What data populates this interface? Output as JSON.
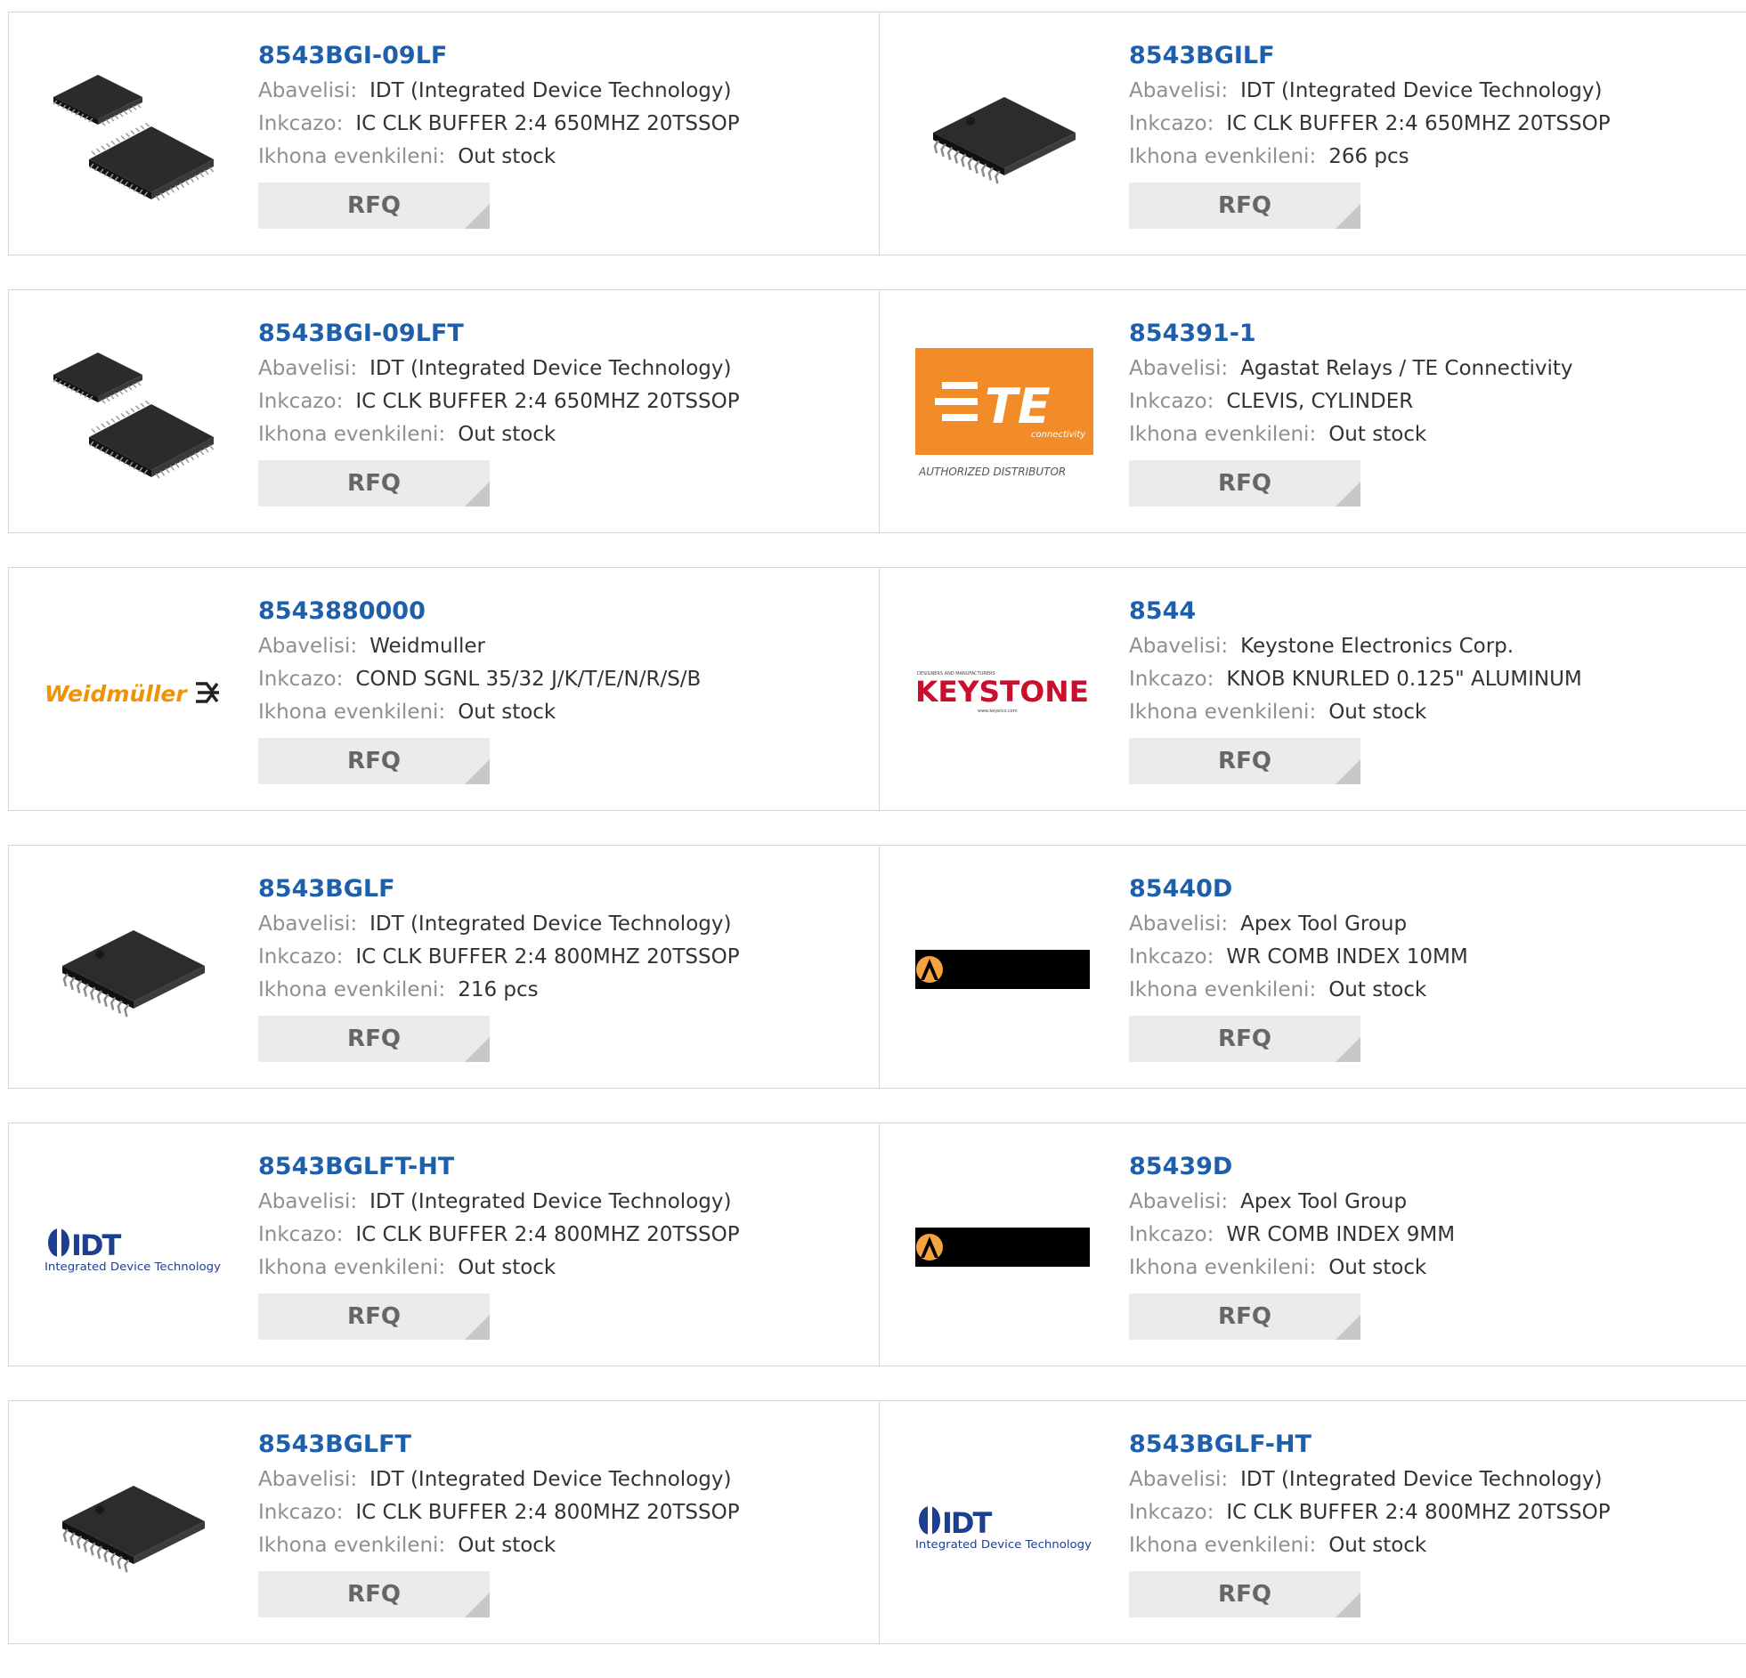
{
  "labels": {
    "manufacturer": "Abavelisi:",
    "description": "Inkcazo:",
    "stock": "Ikhona evenkileni:",
    "rfq": "RFQ"
  },
  "rows": [
    [
      {
        "pn": "8543BGI-09LF",
        "manufacturer": "IDT (Integrated Device Technology)",
        "description": "IC CLK BUFFER 2:4 650MHZ 20TSSOP",
        "stock": "Out stock",
        "image": "chip-qfp-pair-icon"
      },
      {
        "pn": "8543BGILF",
        "manufacturer": "IDT (Integrated Device Technology)",
        "description": "IC CLK BUFFER 2:4 650MHZ 20TSSOP",
        "stock": "266 pcs",
        "image": "chip-tssop-icon"
      }
    ],
    [
      {
        "pn": "8543BGI-09LFT",
        "manufacturer": "IDT (Integrated Device Technology)",
        "description": "IC CLK BUFFER 2:4 650MHZ 20TSSOP",
        "stock": "Out stock",
        "image": "chip-qfp-pair-icon"
      },
      {
        "pn": "854391-1",
        "manufacturer": "Agastat Relays / TE Connectivity",
        "description": "CLEVIS, CYLINDER",
        "stock": "Out stock",
        "image": "te-logo",
        "logo_text": "TE",
        "logo_sub": "connectivity",
        "logo_caption": "AUTHORIZED DISTRIBUTOR"
      }
    ],
    [
      {
        "pn": "8543880000",
        "manufacturer": "Weidmuller",
        "description": "COND SGNL 35/32 J/K/T/E/N/R/S/B",
        "stock": "Out stock",
        "image": "weidmuller-logo",
        "logo_text": "Weidmüller"
      },
      {
        "pn": "8544",
        "manufacturer": "Keystone Electronics Corp.",
        "description": "KNOB KNURLED 0.125\" ALUMINUM",
        "stock": "Out stock",
        "image": "keystone-logo",
        "logo_text": "KEYSTONE"
      }
    ],
    [
      {
        "pn": "8543BGLF",
        "manufacturer": "IDT (Integrated Device Technology)",
        "description": "IC CLK BUFFER 2:4 800MHZ 20TSSOP",
        "stock": "216 pcs",
        "image": "chip-tssop-icon"
      },
      {
        "pn": "85440D",
        "manufacturer": "Apex Tool Group",
        "description": "WR COMB INDEX 10MM",
        "stock": "Out stock",
        "image": "apex-logo"
      }
    ],
    [
      {
        "pn": "8543BGLFT-HT",
        "manufacturer": "IDT (Integrated Device Technology)",
        "description": "IC CLK BUFFER 2:4 800MHZ 20TSSOP",
        "stock": "Out stock",
        "image": "idt-logo",
        "logo_text": "IDT",
        "logo_sub": "Integrated Device Technology"
      },
      {
        "pn": "85439D",
        "manufacturer": "Apex Tool Group",
        "description": "WR COMB INDEX 9MM",
        "stock": "Out stock",
        "image": "apex-logo"
      }
    ],
    [
      {
        "pn": "8543BGLFT",
        "manufacturer": "IDT (Integrated Device Technology)",
        "description": "IC CLK BUFFER 2:4 800MHZ 20TSSOP",
        "stock": "Out stock",
        "image": "chip-tssop-icon"
      },
      {
        "pn": "8543BGLF-HT",
        "manufacturer": "IDT (Integrated Device Technology)",
        "description": "IC CLK BUFFER 2:4 800MHZ 20TSSOP",
        "stock": "Out stock",
        "image": "idt-logo",
        "logo_text": "IDT",
        "logo_sub": "Integrated Device Technology"
      }
    ]
  ],
  "colors": {
    "part_link": "#1f5ea8",
    "label": "#8f8f8f",
    "te_orange": "#f28c28",
    "weidmuller_orange": "#f39200",
    "keystone_red": "#c8102e",
    "idt_blue": "#1d3f8f"
  }
}
